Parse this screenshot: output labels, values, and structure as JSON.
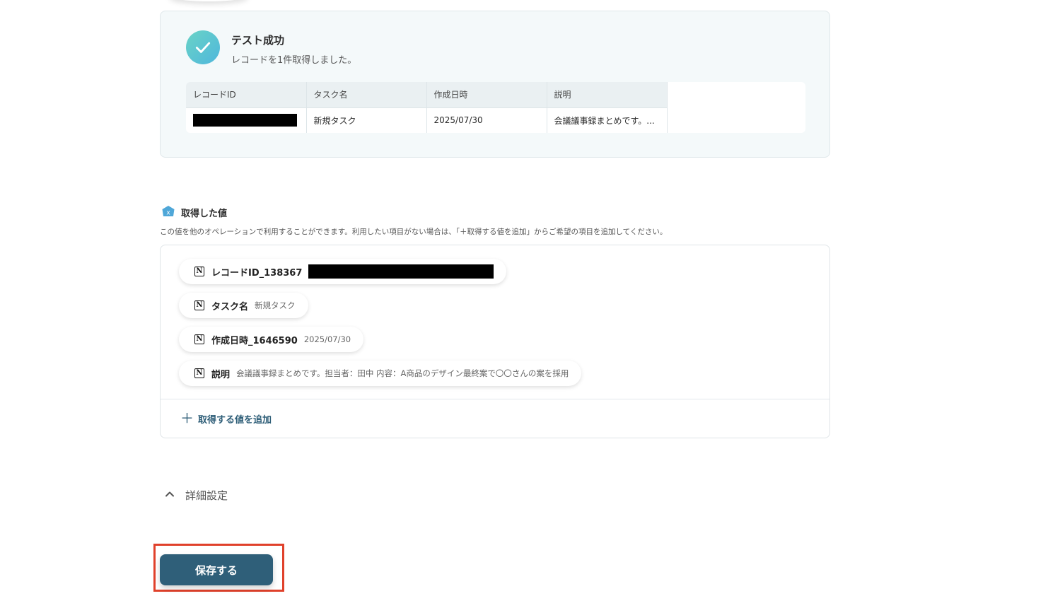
{
  "test_result": {
    "title": "テスト成功",
    "subtitle": "レコードを1件取得しました。",
    "columns": [
      "レコードID",
      "タスク名",
      "作成日時",
      "説明"
    ],
    "row": {
      "task_name": "新規タスク",
      "created_at": "2025/07/30",
      "description": "会議議事録まとめです。..."
    }
  },
  "acquired_values": {
    "title": "取得した値",
    "description": "この値を他のオペレーションで利用することができます。利用したい項目がない場合は、「＋取得する値を追加」からご希望の項目を追加してください。",
    "items": [
      {
        "label": "レコードID_138367",
        "value": ""
      },
      {
        "label": "タスク名",
        "value": "新規タスク"
      },
      {
        "label": "作成日時_1646590",
        "value": "2025/07/30"
      },
      {
        "label": "説明",
        "value": "会議議事録まとめです。担当者：田中 内容：A商品のデザイン最終案で〇〇さんの案を採用"
      }
    ],
    "add_label": "取得する値を追加"
  },
  "advanced_settings": {
    "label": "詳細設定"
  },
  "save_button": {
    "label": "保存する"
  },
  "colors": {
    "primary": "#2f5f79",
    "highlight": "#e0412b",
    "success_gradient_start": "#6ad3c6",
    "success_gradient_end": "#4fb7dc"
  }
}
